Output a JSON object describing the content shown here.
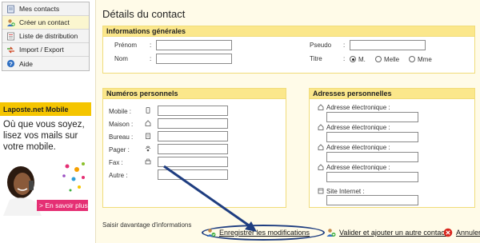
{
  "sidebar": {
    "items": [
      {
        "label": "Mes contacts",
        "icon": "contacts-book-icon"
      },
      {
        "label": "Créer un contact",
        "icon": "add-contact-icon",
        "active": true
      },
      {
        "label": "Liste de distribution",
        "icon": "distribution-list-icon"
      },
      {
        "label": "Import / Export",
        "icon": "import-export-icon"
      },
      {
        "label": "Aide",
        "icon": "help-icon"
      }
    ]
  },
  "promo": {
    "header": "Laposte.net Mobile",
    "text": "Où que vous soyez, lisez vos mails sur votre mobile.",
    "button": "> En savoir plus"
  },
  "page_title": "Détails du contact",
  "general": {
    "title": "Informations générales",
    "prenom_label": "Prénom",
    "nom_label": "Nom",
    "pseudo_label": "Pseudo",
    "titre_label": "Titre",
    "titles": [
      "M.",
      "Melle",
      "Mme"
    ],
    "selected_title": "M."
  },
  "numbers": {
    "title": "Numéros personnels",
    "fields": [
      "Mobile :",
      "Maison :",
      "Bureau :",
      "Pager :",
      "Fax :",
      "Autre :"
    ]
  },
  "addresses": {
    "title": "Adresses personnelles",
    "email_label": "Adresse électronique :",
    "site_label": "Site Internet :"
  },
  "footer": {
    "more_info": "Saisir davantage d'informations",
    "save": "Enregistrer les modifications",
    "save_add": "Valider et ajouter un autre contact",
    "cancel": "Annuler"
  },
  "colors": {
    "accent": "#f5c500",
    "panel_head": "#fbe78b",
    "promo_button": "#e52f74"
  }
}
